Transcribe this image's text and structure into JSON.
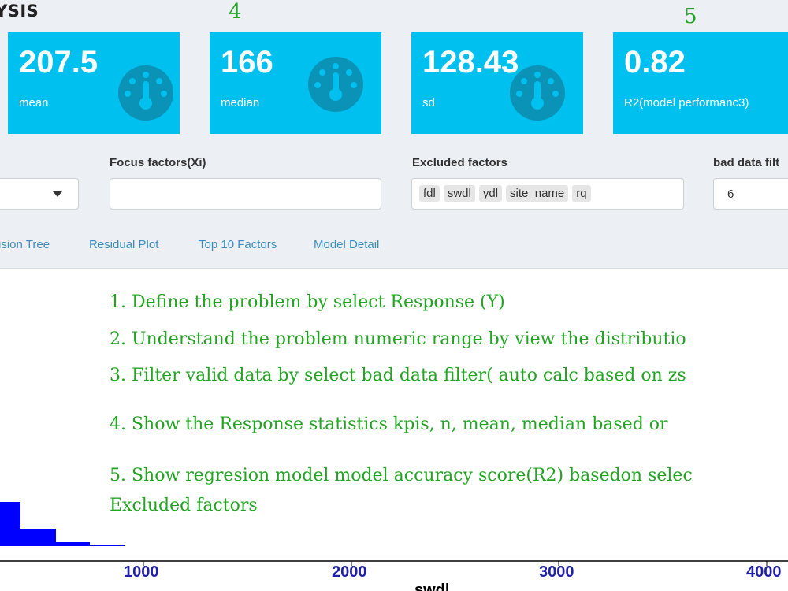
{
  "header": {
    "app_title": "YSIS"
  },
  "step_markers": {
    "kpi_median": "4",
    "kpi_r2": "5"
  },
  "kpis": [
    {
      "value": "207.5",
      "label": "mean"
    },
    {
      "value": "166",
      "label": "median"
    },
    {
      "value": "128.43",
      "label": "sd"
    },
    {
      "value": "0.82",
      "label": "R2(model performanc3)"
    }
  ],
  "filters": {
    "focus_label": "Focus factors(Xi)",
    "focus_value": "",
    "excluded_label": "Excluded factors",
    "excluded_chips": [
      "fdl",
      "swdl",
      "ydl",
      "site_name",
      "rq"
    ],
    "bad_filter_label": "bad data filt",
    "bad_filter_value": "6"
  },
  "tabs": [
    "ision Tree",
    "Residual Plot",
    "Top 10 Factors",
    "Model Detail"
  ],
  "instructions": [
    "1. Define the problem by select Response (Y)",
    "2. Understand the problem numeric range by view the distributio",
    "3. Filter valid data by select bad data filter( auto calc based on zs",
    "4. Show  the Response statistics  kpis, n, mean, median based or",
    "5. Show regresion model model accuracy score(R2) basedon selec",
    "Excluded factors"
  ],
  "chart_data": {
    "type": "bar",
    "xlabel": "swdl",
    "x_ticks": [
      "1000",
      "2000",
      "3000",
      "4000"
    ],
    "color": "#0000ff"
  },
  "colors": {
    "kpi_bg": "#00c0ef",
    "accent_link": "#3c8dbc",
    "instruction_text": "#22a322"
  }
}
